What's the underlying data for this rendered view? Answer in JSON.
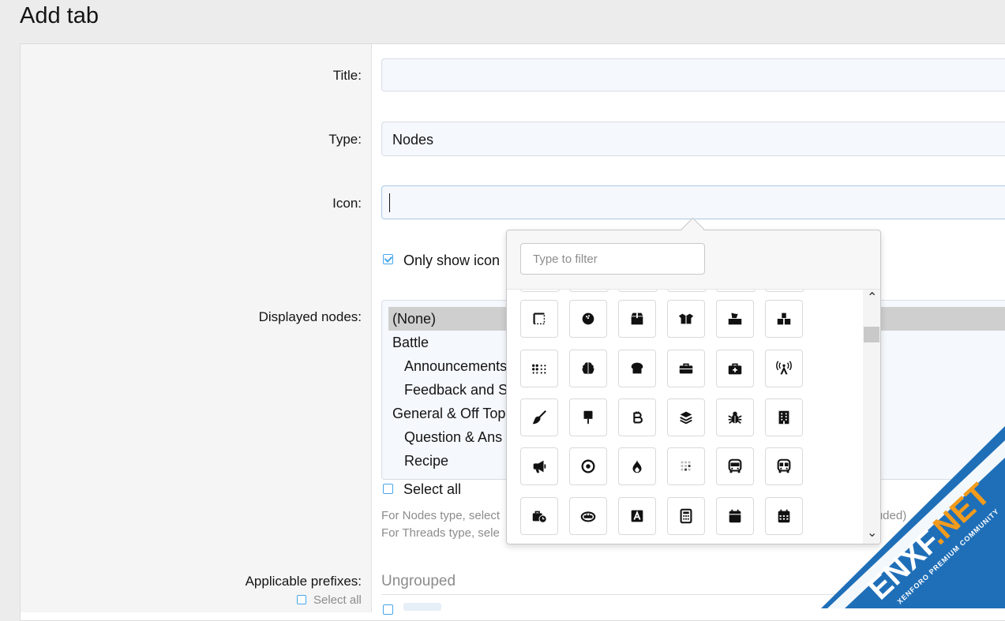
{
  "page": {
    "title": "Add tab"
  },
  "form": {
    "title_label": "Title:",
    "type_label": "Type:",
    "type_value": "Nodes",
    "icon_label": "Icon:",
    "only_icon_label": "Only show icon",
    "displayed_nodes_label": "Displayed nodes:",
    "nodes": [
      {
        "label": "(None)",
        "selected": true
      },
      {
        "label": "Battle",
        "selected": false
      },
      {
        "label": "Announcements",
        "selected": false
      },
      {
        "label": "Feedback and S",
        "selected": false
      },
      {
        "label": "General & Off Top",
        "selected": false
      },
      {
        "label": "Question & Ans",
        "selected": false
      },
      {
        "label": "Recipe",
        "selected": false
      }
    ],
    "select_all_label": "Select all",
    "explain_nodes": "For Nodes type, select",
    "explain_nodes_tail": "cluded)",
    "explain_threads": "For Threads type, sele",
    "applicable_prefixes_label": "Applicable prefixes:",
    "prefixes_select_all": "Select all",
    "ungrouped_label": "Ungrouped"
  },
  "icon_picker": {
    "filter_placeholder": "Type to filter",
    "scroll_up": "⌃",
    "scroll_down": "⌄",
    "rows": [
      [
        "border-top-left-icon",
        "bowling-ball-icon",
        "box-icon",
        "box-open-icon",
        "box-tissue-icon",
        "boxes-stacked-icon"
      ],
      [
        "braille-icon",
        "brain-icon",
        "bread-slice-icon",
        "briefcase-icon",
        "briefcase-medical-icon",
        "tower-broadcast-icon"
      ],
      [
        "broom-icon",
        "brush-icon",
        "bitcoin-sign-icon",
        "layer-group-icon",
        "bug-icon",
        "building-icon"
      ],
      [
        "bullhorn-icon",
        "bullseye-icon",
        "burn-icon",
        "business-time-icon",
        "bus-icon",
        "bus-simple-icon"
      ],
      [
        "business-time-icon",
        "birthday-cake-icon",
        "font-box-icon",
        "calculator-icon",
        "calendar-icon",
        "calendar-days-icon"
      ]
    ]
  },
  "watermark": {
    "brand": "ENXF.NET",
    "tagline": "XENFORO PREMIUM COMMUNITY",
    "color": "#1f6fb8"
  }
}
